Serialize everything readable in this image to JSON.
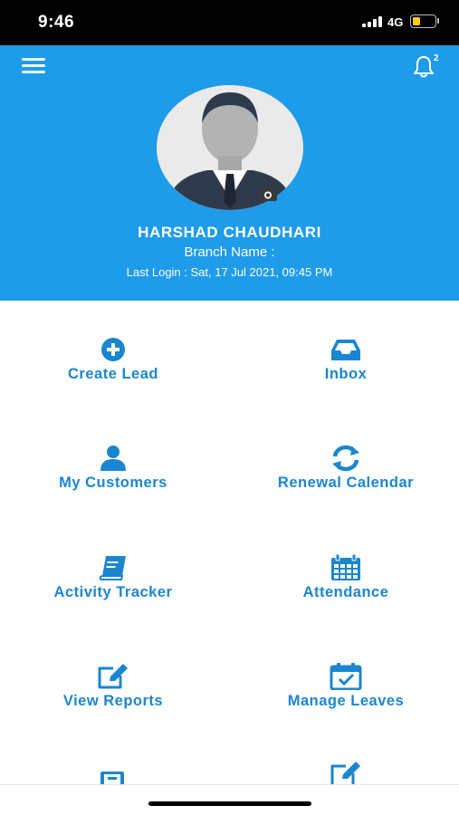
{
  "status_bar": {
    "time": "9:46",
    "network": "4G"
  },
  "header": {
    "notification_count": "2",
    "user_name": "HARSHAD CHAUDHARI",
    "branch_label": "Branch Name :",
    "last_login": "Last Login : Sat, 17 Jul 2021, 09:45 PM"
  },
  "menu": [
    {
      "label": "Create Lead",
      "icon": "plus-circle-icon"
    },
    {
      "label": "Inbox",
      "icon": "inbox-tray-icon"
    },
    {
      "label": "My Customers",
      "icon": "user-icon"
    },
    {
      "label": "Renewal Calendar",
      "icon": "refresh-icon"
    },
    {
      "label": "Activity Tracker",
      "icon": "book-icon"
    },
    {
      "label": "Attendance",
      "icon": "calendar-icon"
    },
    {
      "label": "View Reports",
      "icon": "edit-icon"
    },
    {
      "label": "Manage Leaves",
      "icon": "calendar-check-icon"
    }
  ],
  "colors": {
    "header_bg": "#1e9be9",
    "accent": "#1a86d0",
    "label": "#1a86d0"
  }
}
